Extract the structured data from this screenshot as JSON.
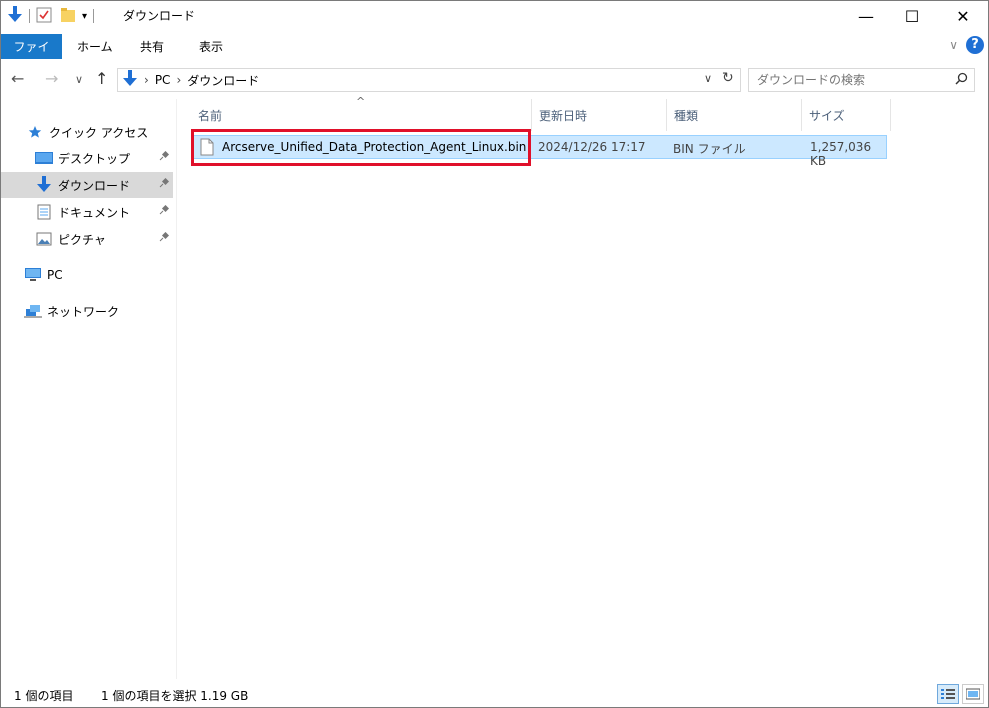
{
  "window": {
    "title": "ダウンロード",
    "minimize_glyph": "—",
    "maximize_glyph": "☐",
    "close_glyph": "✕"
  },
  "ribbon": {
    "tabs": [
      {
        "label": "ファイル",
        "active": true
      },
      {
        "label": "ホーム"
      },
      {
        "label": "共有"
      },
      {
        "label": "表示"
      }
    ],
    "expand_glyph": "∨",
    "help_glyph": "?"
  },
  "nav": {
    "back_glyph": "←",
    "forward_glyph": "→",
    "recent_glyph": "∨",
    "up_glyph": "↑"
  },
  "address": {
    "crumbs": [
      "PC",
      "ダウンロード"
    ],
    "separator": "›",
    "dropdown_glyph": "∨",
    "refresh_glyph": "↻"
  },
  "search": {
    "placeholder": "ダウンロードの検索"
  },
  "sidebar": {
    "items": [
      {
        "label": "クイック アクセス",
        "icon": "star-icon"
      },
      {
        "label": "デスクトップ",
        "icon": "desktop-icon",
        "pinned": true
      },
      {
        "label": "ダウンロード",
        "icon": "download-icon",
        "pinned": true,
        "selected": true
      },
      {
        "label": "ドキュメント",
        "icon": "document-icon",
        "pinned": true
      },
      {
        "label": "ピクチャ",
        "icon": "picture-icon",
        "pinned": true
      },
      {
        "label": "PC",
        "icon": "pc-icon"
      },
      {
        "label": "ネットワーク",
        "icon": "network-icon"
      }
    ],
    "pin_glyph": "📌"
  },
  "file_list": {
    "columns": [
      "名前",
      "更新日時",
      "種類",
      "サイズ"
    ],
    "sort_glyph": "^",
    "rows": [
      {
        "name": "Arcserve_Unified_Data_Protection_Agent_Linux.bin",
        "modified": "2024/12/26 17:17",
        "type": "BIN ファイル",
        "size": "1,257,036 KB",
        "selected": true
      }
    ]
  },
  "status": {
    "item_count": "1 個の項目",
    "selection": "1 個の項目を選択  1.19 GB"
  },
  "colors": {
    "accent": "#1979ca",
    "selection_bg": "#cce8ff",
    "highlight_box": "#e0102a"
  }
}
